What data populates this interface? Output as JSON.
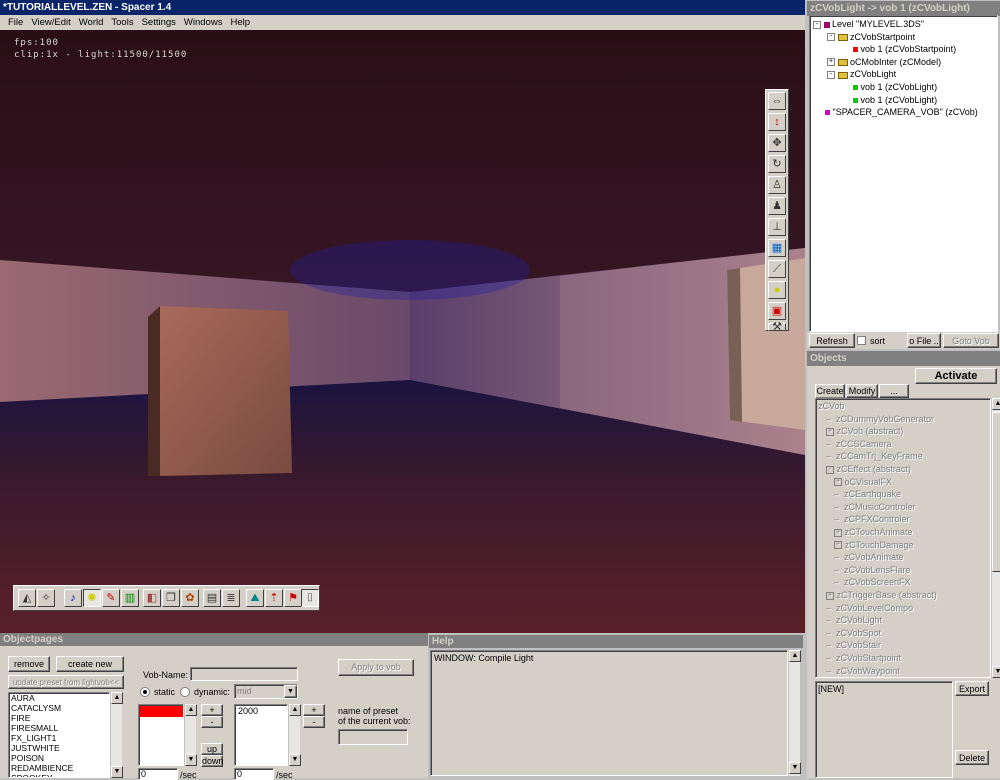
{
  "window_title": "*TUTORIALLEVEL.ZEN - Spacer 1.4",
  "menu": [
    "File",
    "View/Edit",
    "World",
    "Tools",
    "Settings",
    "Windows",
    "Help"
  ],
  "viewport": {
    "fps": "fps:100",
    "clip": "clip:1x - light:11500/11500"
  },
  "vob_tree": {
    "title": "zCVobLight -> vob 1 (zCVobLight)",
    "items": [
      {
        "label": "Level \"MYLEVEL.3DS\"",
        "depth": 0,
        "kind": "level",
        "expander": "-"
      },
      {
        "label": "zCVobStartpoint",
        "depth": 1,
        "kind": "folder",
        "expander": "-"
      },
      {
        "label": "vob 1 (zCVobStartpoint)",
        "depth": 2,
        "kind": "vob",
        "color": "#ff0000"
      },
      {
        "label": "oCMobInter (zCModel)",
        "depth": 1,
        "kind": "folder",
        "expander": "+"
      },
      {
        "label": "zCVobLight",
        "depth": 1,
        "kind": "folder",
        "expander": "-"
      },
      {
        "label": "vob 1 (zCVobLight)",
        "depth": 2,
        "kind": "vob",
        "color": "#00cc00"
      },
      {
        "label": "vob 1 (zCVobLight)",
        "depth": 2,
        "kind": "vob",
        "color": "#00cc00"
      },
      {
        "label": "\"SPACER_CAMERA_VOB\" (zCVob)",
        "depth": 0,
        "kind": "vob",
        "color": "#cc00cc"
      }
    ],
    "refresh": "Refresh",
    "sort": "sort",
    "to_file": "o File ..",
    "goto_vob": "Goto Vob"
  },
  "objects": {
    "title": "Objects",
    "activate": "Activate",
    "tabs": [
      "Create",
      "Modify",
      "..."
    ],
    "items": [
      {
        "label": "zCVob",
        "depth": 0,
        "expander": ""
      },
      {
        "label": "zCDummyVobGenerator",
        "depth": 1,
        "expander": ""
      },
      {
        "label": "zCVob (abstract)",
        "depth": 1,
        "expander": "+"
      },
      {
        "label": "zCCSCamera",
        "depth": 1,
        "expander": ""
      },
      {
        "label": "zCCamTrj_KeyFrame",
        "depth": 1,
        "expander": ""
      },
      {
        "label": "zCEffect (abstract)",
        "depth": 1,
        "expander": "-"
      },
      {
        "label": "oCVisualFX",
        "depth": 2,
        "expander": "+"
      },
      {
        "label": "zCEarthquake",
        "depth": 2,
        "expander": ""
      },
      {
        "label": "zCMusicControler",
        "depth": 2,
        "expander": ""
      },
      {
        "label": "zCPFXControler",
        "depth": 2,
        "expander": ""
      },
      {
        "label": "zCTouchAnimate",
        "depth": 2,
        "expander": "+"
      },
      {
        "label": "zCTouchDamage",
        "depth": 2,
        "expander": "+"
      },
      {
        "label": "zCVobAnimate",
        "depth": 2,
        "expander": ""
      },
      {
        "label": "zCVobLensFlare",
        "depth": 2,
        "expander": ""
      },
      {
        "label": "zCVobScreenFX",
        "depth": 2,
        "expander": ""
      },
      {
        "label": "zCTriggerBase (abstract)",
        "depth": 1,
        "expander": "+"
      },
      {
        "label": "zCVobLevelCompo",
        "depth": 1,
        "expander": ""
      },
      {
        "label": "zCVobLight",
        "depth": 1,
        "expander": ""
      },
      {
        "label": "zCVobSpot",
        "depth": 1,
        "expander": ""
      },
      {
        "label": "zCVobStair",
        "depth": 1,
        "expander": ""
      },
      {
        "label": "zCVobStartpoint",
        "depth": 1,
        "expander": ""
      },
      {
        "label": "zCVobWaypoint",
        "depth": 1,
        "expander": ""
      }
    ],
    "new_text": "[NEW]",
    "export": "Export",
    "delete": "Delete"
  },
  "objectpages": {
    "title": "Objectpages",
    "remove": "remove",
    "create_new": "create new",
    "update_preset": "update preset from lightvob<<",
    "presets": [
      "AURA",
      "CATACLYSM",
      "FIRE",
      "FIRESMALL",
      "FX_LIGHT1",
      "JUSTWHITE",
      "POISON",
      "REDAMBIENCE",
      "SPOOKEY"
    ],
    "vob_name_label": "Vob-Name:",
    "vob_name_value": "",
    "static_label": "static",
    "dynamic_label": "dynamic:",
    "dynamic_option": "mid",
    "apply": "Apply to vob",
    "plus": "+",
    "minus": "-",
    "range_value": "2000",
    "up": "up",
    "down": "down",
    "preset_name_label_1": "name of preset",
    "preset_name_label_2": "of the current vob:",
    "spinner_value_1": "0",
    "spinner_value_2": "0",
    "per_sec": "/sec",
    "color_swatch": "#ff0000"
  },
  "help": {
    "title": "Help",
    "text": "WINDOW: Compile Light"
  }
}
